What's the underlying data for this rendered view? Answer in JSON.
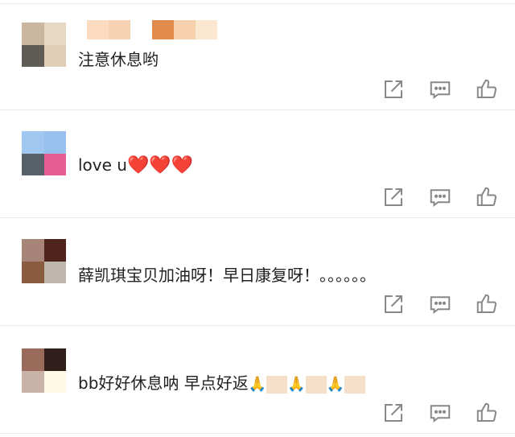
{
  "comments": [
    {
      "text": "注意休息哟",
      "avatar": [
        "#cbb79f",
        "#e7d8c3",
        "#5e5c55",
        "#e0cdb6"
      ],
      "name_colors": [
        "#fbdcc0",
        "#f7d2b2",
        "#ffffff",
        "#e08a4c",
        "#f6d0ac",
        "#fbe6cf"
      ]
    },
    {
      "text": "love u",
      "hearts": "❤️❤️❤️",
      "avatar": [
        "#9fc7f0",
        "#97c0ee",
        "#58606a",
        "#e75e95"
      ]
    },
    {
      "text": "薛凯琪宝贝加油呀！早日康复呀！。。。。。。",
      "avatar": [
        "#a68478",
        "#4e241c",
        "#8a5b3f",
        "#bfb7af"
      ]
    },
    {
      "text": "bb好好休息呐 早点好返",
      "emojis": "🙏🙏🙏",
      "avatar": [
        "#9a6b5a",
        "#2f1e1c",
        "#c9b3a8",
        "#fff9e6"
      ]
    }
  ],
  "icons": {
    "share": "share-icon",
    "comment": "comment-icon",
    "like": "thumbs-up-icon"
  },
  "colors": {
    "text": "#222222",
    "icon": "#888888",
    "divider": "#e8e8e8",
    "heart": "#e8242c"
  }
}
